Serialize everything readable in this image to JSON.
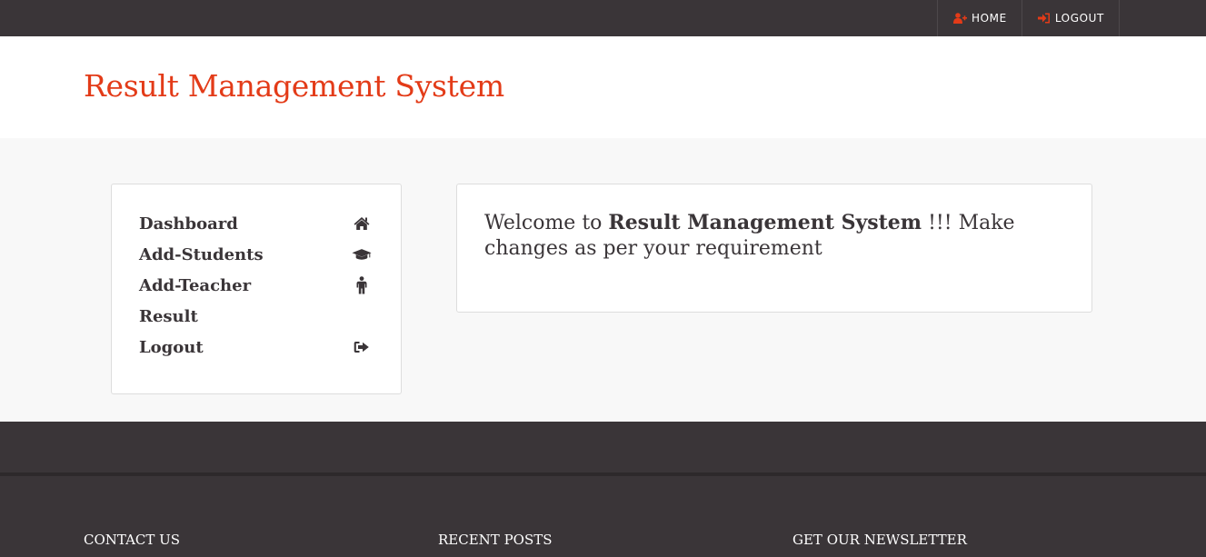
{
  "topnav": {
    "home_label": "HOME",
    "logout_label": "LOGOUT",
    "accent_color": "#e33b18"
  },
  "header": {
    "title": "Result Management System"
  },
  "sidebar": {
    "items": [
      {
        "label": "Dashboard",
        "icon": "home-icon"
      },
      {
        "label": "Add-Students",
        "icon": "graduation-cap-icon"
      },
      {
        "label": "Add-Teacher",
        "icon": "male-icon"
      },
      {
        "label": "Result",
        "icon": ""
      },
      {
        "label": "Logout",
        "icon": "sign-out-icon"
      }
    ]
  },
  "main": {
    "welcome_prefix": "Welcome to ",
    "welcome_bold": "Result Management System",
    "welcome_suffix": " !!! Make changes as per your requirement"
  },
  "footer": {
    "contact_heading": "CONTACT US",
    "posts_heading": "RECENT POSTS",
    "newsletter_heading": "GET OUR NEWSLETTER"
  }
}
